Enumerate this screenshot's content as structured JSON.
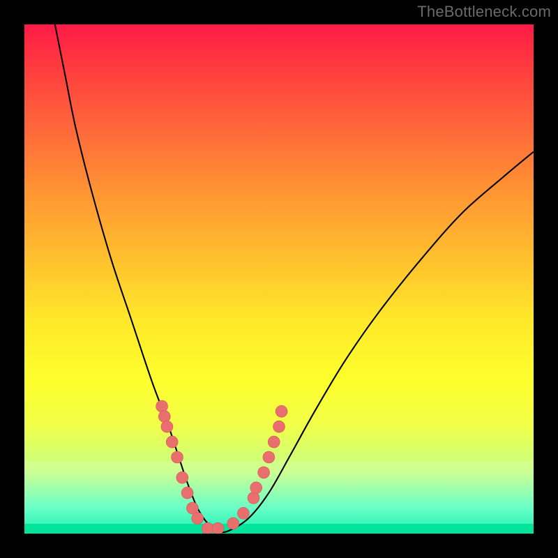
{
  "watermark": "TheBottleneck.com",
  "chart_data": {
    "type": "line",
    "title": "",
    "xlabel": "",
    "ylabel": "",
    "xlim": [
      0,
      100
    ],
    "ylim": [
      0,
      100
    ],
    "series": [
      {
        "name": "bottleneck-curve",
        "x": [
          6,
          8,
          10,
          13,
          17,
          21,
          25,
          28,
          30,
          32,
          34,
          36,
          38,
          40,
          44,
          48,
          52,
          57,
          63,
          70,
          78,
          86,
          94,
          100
        ],
        "y": [
          100,
          90,
          80,
          68,
          54,
          42,
          30,
          22,
          16,
          10,
          5,
          2,
          0.5,
          0.5,
          3,
          8,
          15,
          24,
          34,
          44,
          54,
          63,
          70,
          75
        ]
      }
    ],
    "markers": {
      "name": "highlighted-points",
      "x": [
        27,
        27.5,
        28,
        29,
        30,
        31,
        32,
        33,
        34,
        36,
        38,
        41,
        43,
        45,
        45.5,
        47,
        48,
        49,
        50,
        50.5
      ],
      "y": [
        25,
        23,
        21,
        18,
        15,
        11,
        8,
        5,
        3,
        1,
        1,
        2,
        4,
        7,
        9,
        12,
        15,
        18,
        21,
        24
      ]
    },
    "background": {
      "type": "vertical-gradient",
      "stops": [
        {
          "pos": 0.0,
          "color": "#ff1a47"
        },
        {
          "pos": 0.2,
          "color": "#ff663b"
        },
        {
          "pos": 0.46,
          "color": "#ffc02d"
        },
        {
          "pos": 0.7,
          "color": "#feff2c"
        },
        {
          "pos": 0.95,
          "color": "#55ffc0"
        },
        {
          "pos": 1.0,
          "color": "#00f0a8"
        }
      ]
    }
  }
}
